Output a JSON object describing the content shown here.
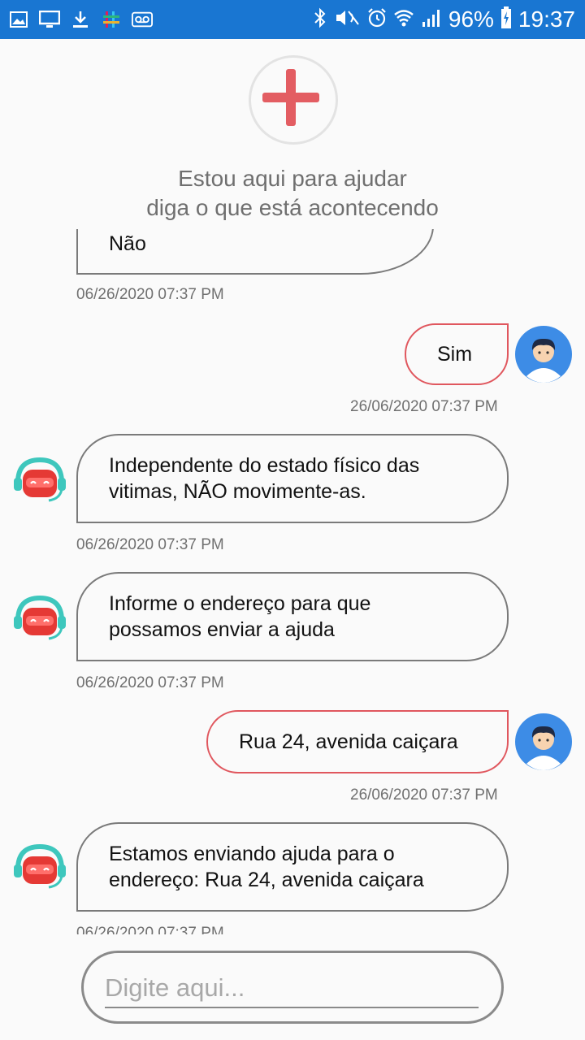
{
  "status_bar": {
    "battery": "96%",
    "time": "19:37",
    "left_icons": [
      "image-icon",
      "monitor-icon",
      "download-icon",
      "slack-icon",
      "voicemail-icon"
    ],
    "right_icons": [
      "bluetooth-icon",
      "mute-icon",
      "alarm-icon",
      "wifi-icon",
      "signal-icon",
      "battery-charging-icon"
    ]
  },
  "header": {
    "logo_icon": "red-cross-icon",
    "intro_line1": "Estou aqui para ajudar",
    "intro_line2": "diga o que está acontecendo"
  },
  "messages": [
    {
      "sender": "bot",
      "text": "Não",
      "time": "06/26/2020 07:37 PM"
    },
    {
      "sender": "user",
      "text": "Sim",
      "time": "26/06/2020 07:37 PM"
    },
    {
      "sender": "bot",
      "line1": "Independente do estado físico das",
      "line2": "vitimas, NÃO movimente-as.",
      "time": "06/26/2020 07:37 PM"
    },
    {
      "sender": "bot",
      "line1": "Informe o endereço para que",
      "line2": "possamos enviar a ajuda",
      "time": "06/26/2020 07:37 PM"
    },
    {
      "sender": "user",
      "text": "Rua 24, avenida caiçara",
      "time": "26/06/2020 07:37 PM"
    },
    {
      "sender": "bot",
      "line1": "Estamos enviando ajuda para o",
      "line2": "endereço: Rua 24, avenida caiçara",
      "time": "06/26/2020 07:37 PM"
    }
  ],
  "composer": {
    "placeholder": "Digite aqui..."
  },
  "colors": {
    "status_bar": "#1976d2",
    "user_bubble_border": "#e0575e",
    "bot_bubble_border": "#7a7a7a",
    "cross": "#e35d62",
    "bot_avatar_head": "#3ec7bd",
    "bot_avatar_face": "#e53935",
    "user_avatar_bg": "#3d8ce6"
  }
}
